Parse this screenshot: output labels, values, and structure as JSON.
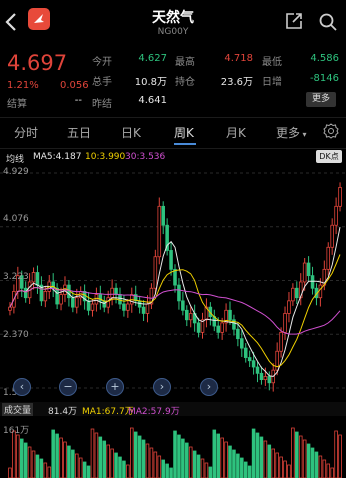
{
  "header": {
    "title": "天然气",
    "code": "NG00Y",
    "back_icon": "chevron-left-icon",
    "logo_icon": "app-logo-icon",
    "share_icon": "share-icon",
    "search_icon": "search-icon"
  },
  "quote": {
    "price": "4.697",
    "change_pct": "1.21%",
    "change": "0.056",
    "stats": [
      {
        "label": "今开",
        "value": "4.627",
        "tone": "green"
      },
      {
        "label": "最高",
        "value": "4.718",
        "tone": "red"
      },
      {
        "label": "最低",
        "value": "4.586",
        "tone": "green"
      },
      {
        "label": "总手",
        "value": "10.8万",
        "tone": "white"
      },
      {
        "label": "持仓",
        "value": "23.6万",
        "tone": "white"
      },
      {
        "label": "日增",
        "value": "-8146",
        "tone": "green"
      },
      {
        "label": "结算",
        "value": "--",
        "tone": "white"
      },
      {
        "label": "昨结",
        "value": "4.641",
        "tone": "white"
      }
    ],
    "more_label": "更多"
  },
  "tabs": [
    "分时",
    "五日",
    "日K",
    "周K",
    "月K",
    "更多"
  ],
  "active_tab": "周K",
  "settings_icon": "gear-icon",
  "chart_legend": {
    "main": "均线",
    "ma5": "MA5:4.187",
    "ma10": "10:3.990",
    "ma30": "30:3.536",
    "badge": "DK点"
  },
  "controls": [
    "chevron-left-icon",
    "minus-icon",
    "plus-icon",
    "chevron-right-icon"
  ],
  "volume": {
    "label": "成交量",
    "value": "81.4万",
    "ma1": "MA1:67.7万",
    "ma2": "MA2:57.9万",
    "tick": "161万"
  },
  "colors": {
    "up": "#e0443a",
    "down": "#2ec27e",
    "ma5": "#e8e8e8",
    "ma10": "#f0d000",
    "ma30": "#d050d0"
  },
  "chart_data": {
    "type": "line",
    "ylim": [
      1.517,
      4.929
    ],
    "y_ticks": [
      "4.929",
      "4.076",
      "3.223",
      "2.370",
      "1.517"
    ],
    "closes": [
      2.8,
      3.05,
      3.3,
      3.1,
      2.95,
      3.2,
      3.35,
      3.15,
      2.9,
      3.05,
      3.2,
      3.1,
      2.85,
      3.0,
      3.15,
      2.95,
      2.8,
      2.95,
      3.05,
      2.9,
      2.75,
      2.85,
      3.0,
      2.9,
      2.8,
      2.95,
      3.1,
      3.0,
      2.85,
      2.75,
      2.85,
      3.0,
      2.9,
      2.8,
      2.7,
      2.85,
      3.1,
      3.6,
      4.4,
      4.1,
      3.7,
      3.4,
      3.15,
      2.9,
      2.75,
      2.6,
      2.7,
      2.55,
      2.4,
      2.6,
      2.8,
      2.65,
      2.5,
      2.4,
      2.55,
      2.75,
      2.6,
      2.45,
      2.3,
      2.15,
      2.0,
      1.95,
      1.85,
      1.75,
      1.65,
      1.7,
      1.6,
      1.8,
      2.1,
      2.4,
      2.7,
      2.9,
      3.1,
      2.95,
      3.2,
      3.5,
      3.3,
      3.1,
      2.95,
      3.15,
      3.4,
      3.75,
      4.1,
      4.4,
      4.7
    ]
  }
}
